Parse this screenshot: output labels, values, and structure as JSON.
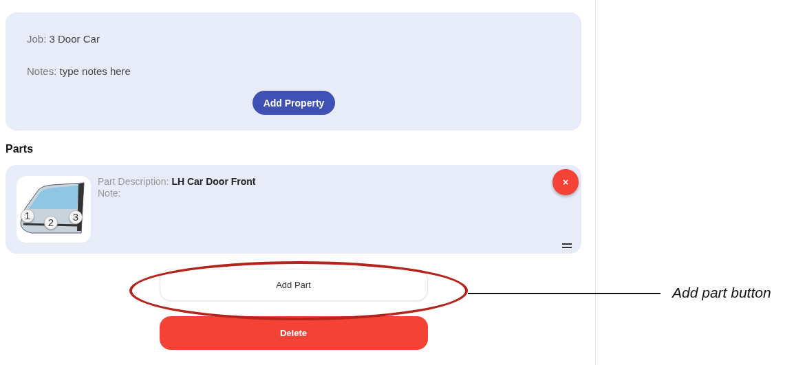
{
  "job_card": {
    "fields": [
      {
        "label": "Job:",
        "value": "3 Door Car"
      },
      {
        "label": "Notes:",
        "value": "type notes here"
      }
    ],
    "add_property_button": "Add Property"
  },
  "parts_heading": "Parts",
  "parts": [
    {
      "description_label": "Part Description:",
      "description": "LH Car Door Front",
      "note_label": "Note:",
      "markers": [
        "1",
        "2",
        "3"
      ],
      "remove_button": "×"
    }
  ],
  "add_part_button": "Add Part",
  "delete_button": "Delete",
  "annotation": {
    "text": "Add part button"
  }
}
